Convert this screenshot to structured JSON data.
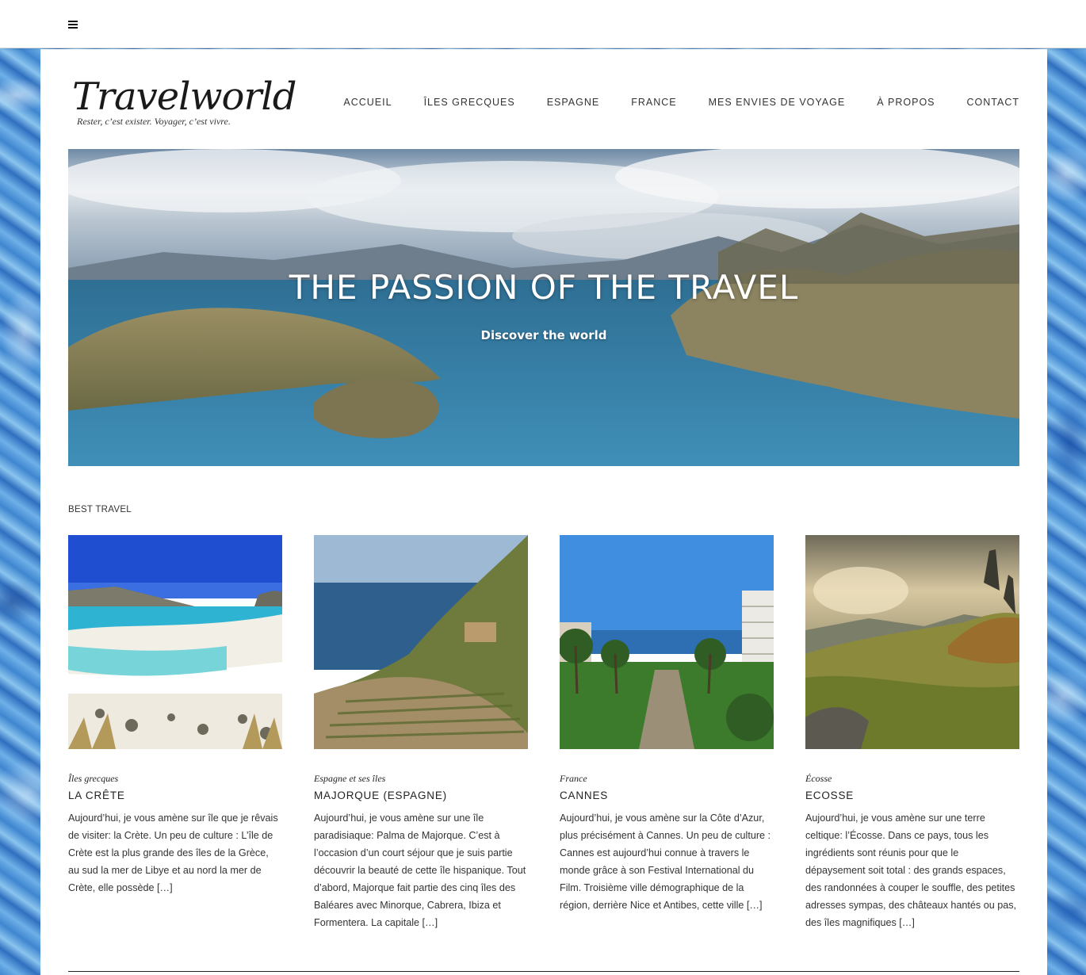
{
  "topbar": {
    "menu_icon": "hamburger-menu-icon"
  },
  "site": {
    "title": "Travelworld",
    "tagline": "Rester, c’est exister. Voyager, c’est vivre."
  },
  "nav": {
    "items": [
      {
        "label": "ACCUEIL"
      },
      {
        "label": "ÎLES GRECQUES"
      },
      {
        "label": "ESPAGNE"
      },
      {
        "label": "FRANCE"
      },
      {
        "label": "MES ENVIES DE VOYAGE"
      },
      {
        "label": "À PROPOS"
      },
      {
        "label": "CONTACT"
      }
    ]
  },
  "hero": {
    "title": "THE PASSION OF THE TRAVEL",
    "subtitle": "Discover the world"
  },
  "section": {
    "label": "BEST TRAVEL"
  },
  "posts": [
    {
      "category": "Îles grecques",
      "title": "LA CRÊTE",
      "excerpt": "Aujourd’hui, je vous amène sur île que je rêvais de visiter: la Crète. Un peu de culture : L’île de Crète est la plus grande des îles de la Grèce, au sud la mer de Libye et au nord la mer de Crète, elle possède […]"
    },
    {
      "category": "Espagne et ses îles",
      "title": "MAJORQUE (ESPAGNE)",
      "excerpt": "Aujourd’hui, je vous amène sur une île paradisiaque: Palma de Majorque. C’est à l’occasion d’un court séjour que je suis partie découvrir la beauté de cette île hispanique. Tout d’abord, Majorque fait partie des cinq îles des Baléares avec Minorque, Cabrera, Ibiza et Formentera. La capitale […]"
    },
    {
      "category": "France",
      "title": "CANNES",
      "excerpt": "Aujourd’hui, je vous amène sur la Côte d’Azur, plus précisément à Cannes.   Un peu de culture : Cannes est aujourd’hui connue à travers le monde grâce à son Festival International du Film. Troisième ville démographique de la région, derrière Nice et Antibes, cette ville […]"
    },
    {
      "category": "Écosse",
      "title": "ECOSSE",
      "excerpt": "Aujourd’hui, je vous amène sur une terre celtique: l’Écosse. Dans ce pays, tous les ingrédients sont réunis pour que le dépaysement soit total : des grands espaces, des randonnées à couper le souffle, des petites adresses sympas, des châteaux hantés ou pas, des îles magnifiques […]"
    }
  ]
}
